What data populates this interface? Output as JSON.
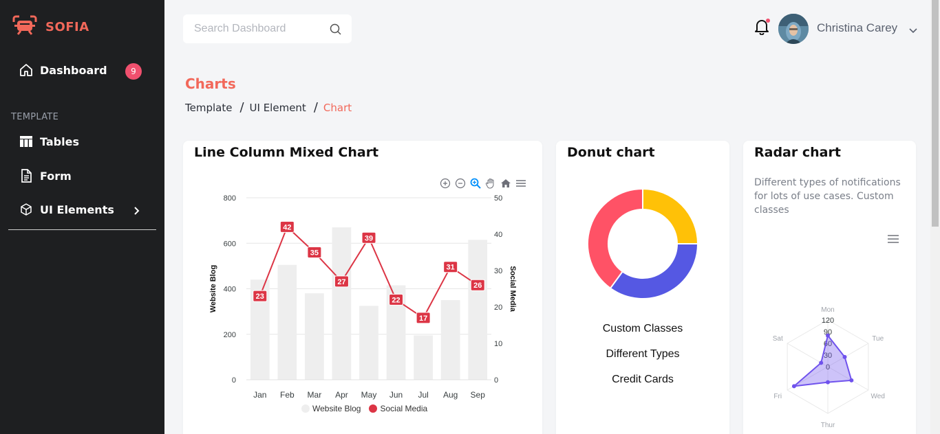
{
  "brand": {
    "name": "SOFIA",
    "accent": "#f2685a"
  },
  "sidebar": {
    "items": [
      {
        "label": "Dashboard",
        "icon": "home-icon",
        "badge": "9"
      },
      {
        "label": "Tables",
        "icon": "table-icon"
      },
      {
        "label": "Form",
        "icon": "form-icon"
      },
      {
        "label": "UI Elements",
        "icon": "cube-icon"
      }
    ],
    "section_label": "TEMPLATE"
  },
  "header": {
    "search_placeholder": "Search Dashboard",
    "user_name": "Christina Carey"
  },
  "page": {
    "title": "Charts",
    "breadcrumbs": [
      "Template",
      "UI Element",
      "Chart"
    ]
  },
  "cards": {
    "mixed": {
      "title": "Line Column Mixed Chart"
    },
    "donut": {
      "title": "Donut chart",
      "legend": [
        "Custom Classes",
        "Different Types",
        "Credit Cards"
      ]
    },
    "radar": {
      "title": "Radar chart",
      "description": "Different types of notifications for lots of use cases. Custom classes"
    }
  },
  "chart_data": [
    {
      "type": "bar",
      "categories": [
        "Jan",
        "Feb",
        "Mar",
        "Apr",
        "May",
        "Jun",
        "Jul",
        "Aug",
        "Sep"
      ],
      "series": [
        {
          "name": "Website Blog",
          "type": "bar",
          "axis": "left",
          "values": [
            440,
            505,
            380,
            670,
            325,
            415,
            195,
            350,
            615
          ],
          "color": "#eeeeee"
        },
        {
          "name": "Social Media",
          "type": "line",
          "axis": "right",
          "values": [
            23,
            42,
            35,
            27,
            39,
            22,
            17,
            31,
            26
          ],
          "color": "#dc3545"
        }
      ],
      "ylabel": "Website Blog",
      "y2label": "Social Media",
      "ylim": [
        0,
        800
      ],
      "y2lim": [
        0,
        50
      ],
      "yticks": [
        0,
        200,
        400,
        600,
        800
      ],
      "y2ticks": [
        0,
        10,
        20,
        30,
        40,
        50
      ],
      "legend": "bottom"
    },
    {
      "type": "pie",
      "variant": "donut",
      "categories": [
        "Custom Classes",
        "Different Types",
        "Credit Cards"
      ],
      "values": [
        25,
        35,
        40
      ],
      "colors": [
        "#ffc107",
        "#5558e3",
        "#ff5266"
      ]
    },
    {
      "type": "radar",
      "categories": [
        "Mon",
        "Tue",
        "Wed",
        "Thur",
        "Fri",
        "Sat"
      ],
      "values": [
        80,
        50,
        70,
        40,
        100,
        20
      ],
      "ylim": [
        0,
        120
      ],
      "ticks": [
        0,
        30,
        60,
        90,
        120
      ],
      "color": "#6f52ed"
    }
  ]
}
